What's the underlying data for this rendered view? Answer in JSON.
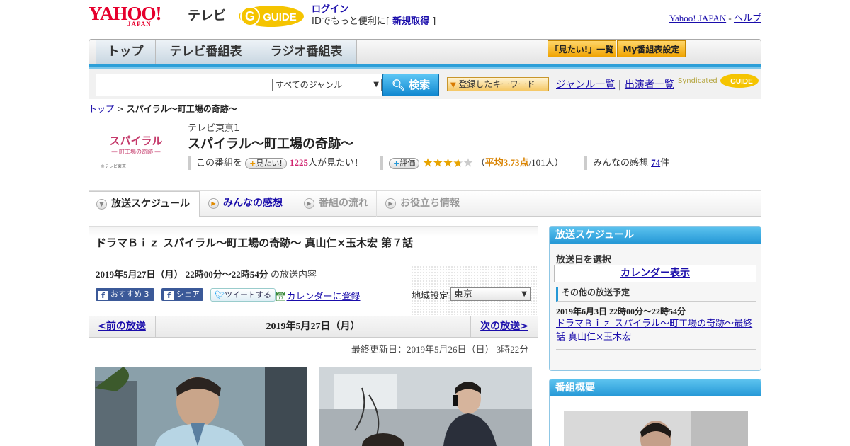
{
  "header": {
    "yahoo_logo": "YAHOO!",
    "yahoo_japan": "JAPAN",
    "tv_label": "テレビ",
    "gguide_logo": "GUIDE",
    "login_link": "ログイン",
    "login_prompt": "IDでもっと便利に[",
    "register_link": "新規取得",
    "login_suffix": "]",
    "yahoo_japan_link": "Yahoo! JAPAN",
    "separator": "-",
    "help_link": "ヘルプ"
  },
  "nav": {
    "tabs": [
      {
        "label": "トップ"
      },
      {
        "label": "テレビ番組表"
      },
      {
        "label": "ラジオ番組表"
      }
    ],
    "mitai_list": "「見たい!」一覧",
    "my_schedule": "My番組表設定"
  },
  "search": {
    "query": "",
    "genre": "すべてのジャンル",
    "button": "検索",
    "keyword_button": "登録したキーワード",
    "genre_list_link": "ジャンル一覧",
    "divider": "|",
    "cast_list_link": "出演者一覧",
    "syndicated": "Syndicated",
    "gguide_logo": "GUIDE"
  },
  "breadcrumb": {
    "home": "トップ",
    "sep": ">",
    "current": "スパイラル～町工場の奇跡～"
  },
  "program": {
    "thumb_title": "スパイラル",
    "thumb_subtitle": "― 町工場の奇跡 ―",
    "thumb_copyright": "©テレビ東京",
    "channel": "テレビ東京1",
    "title": "スパイラル～町工場の奇跡～",
    "mitai_prefix": "この番組を",
    "mitai_button": "見たい!",
    "mitai_count": "1225",
    "mitai_suffix": "人が見たい！",
    "rate_button": "評価",
    "rating": 3.73,
    "rating_open": "（",
    "rating_avg": "平均3.73点",
    "rating_count": "/101人）",
    "reviews_label": "みんなの感想",
    "reviews_count": "74",
    "reviews_suffix": "件"
  },
  "content_tabs": [
    {
      "label": "放送スケジュール"
    },
    {
      "label": "みんなの感想"
    },
    {
      "label": "番組の流れ"
    },
    {
      "label": "お役立ち情報"
    }
  ],
  "broadcast": {
    "episode_title": "ドラマＢｉｚ スパイラル～町工場の奇跡～ 真山仁×玉木宏 第７話",
    "time": "2019年5月27日（月） 22時00分～22時54分",
    "time_suffix": "の放送内容",
    "recommend": "おすすめ 3",
    "share": "シェア",
    "tweet": "ツイートする",
    "calendar_register": "カレンダーに登録",
    "region_label": "地域設定",
    "region": "東京"
  },
  "pager": {
    "prev": "<前の放送",
    "date": "2019年5月27日（月）",
    "next": "次の放送>"
  },
  "updated": "最終更新日：2019年5月26日（日） 3時22分",
  "sidebar": {
    "schedule_title": "放送スケジュール",
    "select_date": "放送日を選択",
    "calendar_button": "カレンダー表示",
    "other_heading": "その他の放送予定",
    "other_time": "2019年6月3日 22時00分～22時54分",
    "other_link": "ドラマＢｉｚ スパイラル～町工場の奇跡～最終話 真山仁×玉木宏",
    "overview_title": "番組概要"
  },
  "colors": {
    "accent_blue": "#2598d6",
    "yahoo_red": "#e6002d",
    "pink": "#d1246f",
    "star_orange": "#e8a400"
  }
}
